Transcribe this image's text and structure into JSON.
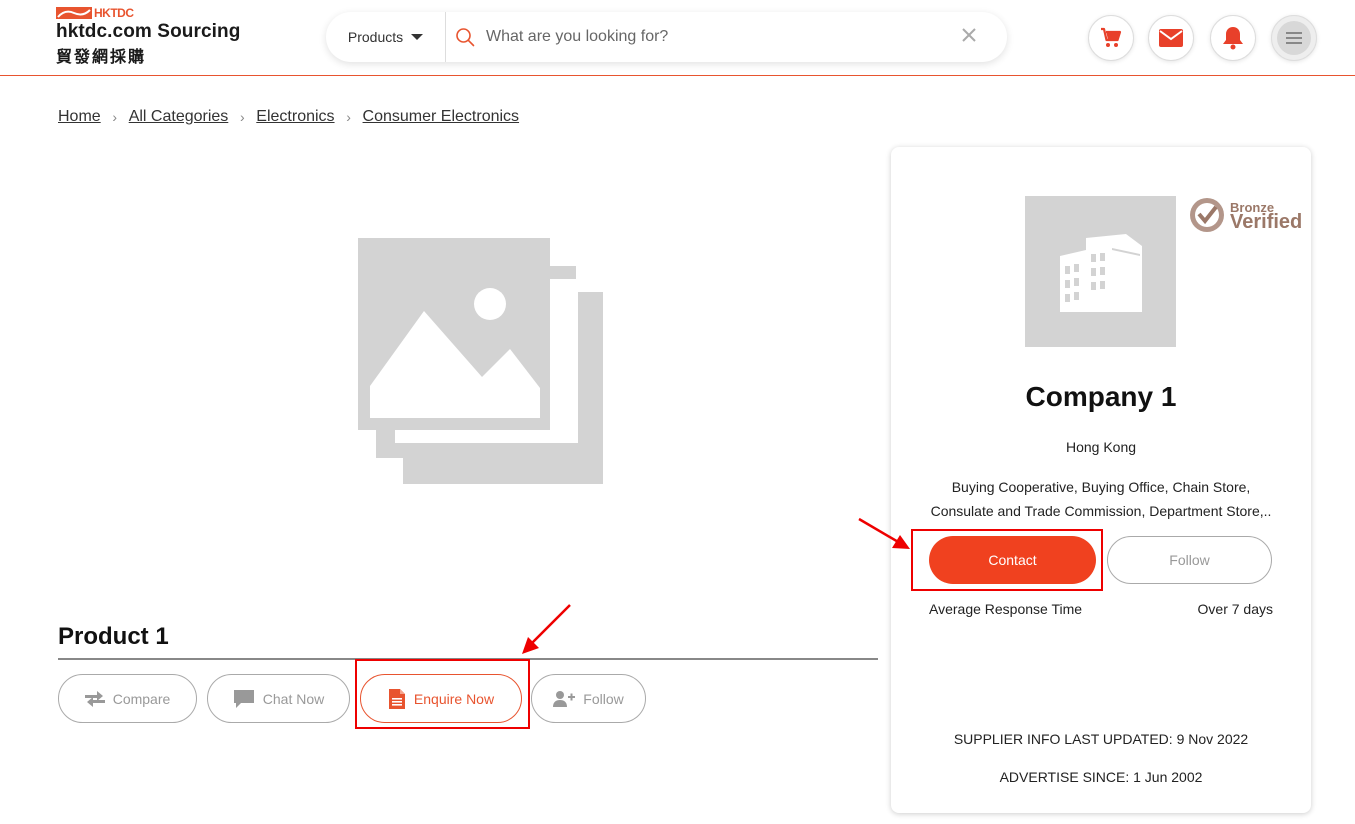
{
  "header": {
    "logo": {
      "brand_mark": "HKTDC",
      "title": "hktdc.com Sourcing",
      "subtitle_cn": "貿發網採購"
    },
    "search": {
      "category": "Products",
      "placeholder": "What are you looking for?"
    },
    "icons": [
      "cart-icon",
      "mail-icon",
      "bell-icon",
      "menu-icon"
    ],
    "accent_color": "#e8542f"
  },
  "breadcrumb": [
    "Home",
    "All Categories",
    "Electronics",
    "Consumer Electronics"
  ],
  "product": {
    "title": "Product 1",
    "actions": {
      "compare": "Compare",
      "chat": "Chat Now",
      "enquire": "Enquire Now",
      "follow": "Follow"
    }
  },
  "supplier": {
    "verification": {
      "level": "Bronze",
      "label": "Verified"
    },
    "name": "Company 1",
    "location": "Hong Kong",
    "business_types": "Buying Cooperative, Buying Office, Chain Store, Consulate and Trade Commission, Department Store,..",
    "contact_label": "Contact",
    "follow_label": "Follow",
    "response_time_label": "Average Response Time",
    "response_time_value": "Over 7 days",
    "last_updated": "SUPPLIER INFO LAST UPDATED: 9 Nov 2022",
    "advertise_since": "ADVERTISE SINCE: 1 Jun 2002",
    "contact_color": "#f0411f",
    "verified_color": "#9b7868"
  },
  "annotations": {
    "highlight_color": "#e00000"
  }
}
